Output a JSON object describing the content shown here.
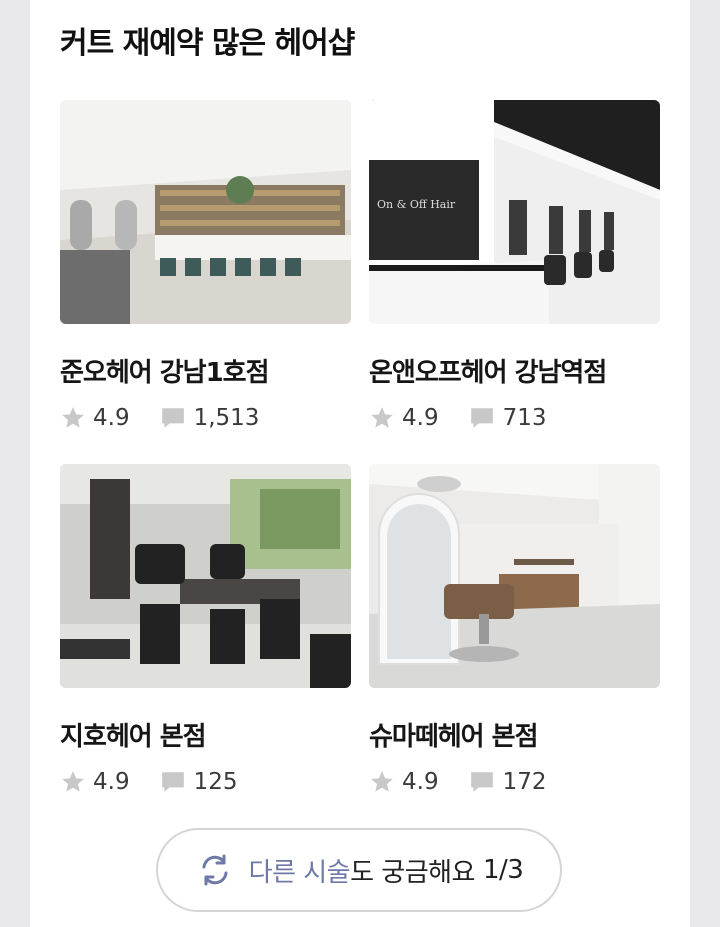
{
  "section": {
    "title": "커트 재예약 많은 헤어샵"
  },
  "shops": [
    {
      "name": "준오헤어 강남1호점",
      "rating": "4.9",
      "reviews": "1,513",
      "photo": "salon-photo-bright-interior"
    },
    {
      "name": "온앤오프헤어 강남역점",
      "rating": "4.9",
      "reviews": "713",
      "photo": "salon-photo-black-white-interior",
      "photo_sign": "On & Off Hair"
    },
    {
      "name": "지호헤어 본점",
      "rating": "4.9",
      "reviews": "125",
      "photo": "salon-photo-dark-chairs"
    },
    {
      "name": "슈마떼헤어 본점",
      "rating": "4.9",
      "reviews": "172",
      "photo": "salon-photo-arched-mirror"
    }
  ],
  "more_button": {
    "accent_text": "다른 시술",
    "text": "도 궁금해요",
    "page": "1/3",
    "icon": "refresh-icon"
  },
  "colors": {
    "accent": "#6f79a8",
    "star": "#c8c8c8",
    "bubble": "#c8c8c8",
    "background": "#e9e9ec"
  }
}
